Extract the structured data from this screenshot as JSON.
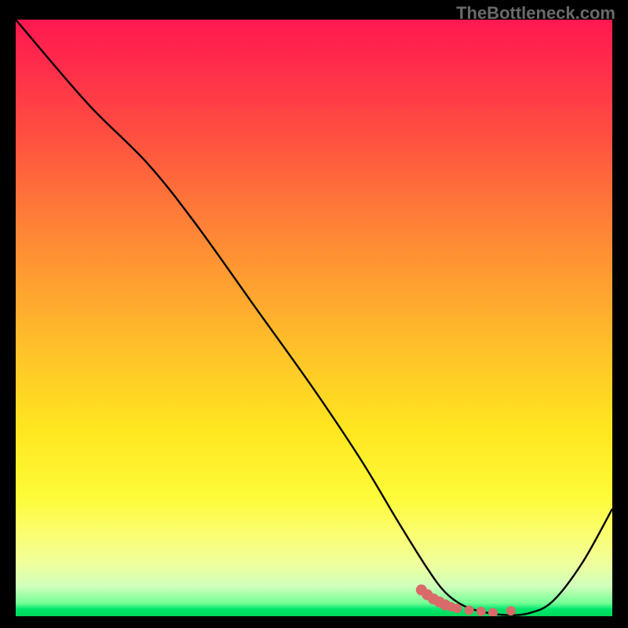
{
  "watermark": "TheBottleneck.com",
  "chart_data": {
    "type": "line",
    "title": "",
    "xlabel": "",
    "ylabel": "",
    "xlim": [
      0,
      100
    ],
    "ylim": [
      0,
      100
    ],
    "series": [
      {
        "name": "bottleneck-curve",
        "x": [
          0,
          12,
          22,
          30,
          40,
          50,
          58,
          64,
          69,
          72,
          75,
          78,
          82,
          86,
          90,
          95,
          100
        ],
        "values": [
          100,
          86,
          76,
          66,
          52,
          38,
          26,
          16,
          8,
          4,
          1.8,
          0.8,
          0.2,
          0.5,
          2.5,
          9,
          18
        ]
      }
    ],
    "markers": {
      "name": "highlighted-points",
      "x": [
        68,
        69,
        70,
        71,
        72,
        73,
        74,
        76,
        78,
        80,
        83
      ],
      "values": [
        4.4,
        3.6,
        2.9,
        2.4,
        1.9,
        1.6,
        1.3,
        1.0,
        0.8,
        0.6,
        0.9
      ]
    },
    "gradient_note": "background vertical gradient maps y-value to color: top red (high bottleneck) through orange, yellow, to green at bottom (optimal)"
  }
}
